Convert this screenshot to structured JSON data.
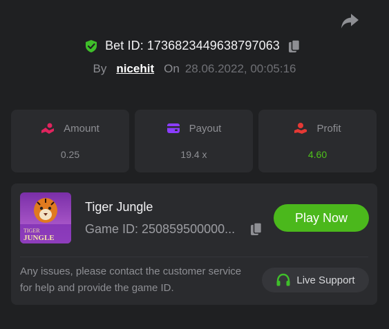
{
  "header": {
    "bet_label": "Bet ID:",
    "bet_id": "1736823449638797063",
    "by_label": "By",
    "username": "nicehit",
    "on_label": "On",
    "datetime": "28.06.2022, 00:05:16"
  },
  "stats": [
    {
      "label": "Amount",
      "value": "0.25",
      "icon": "amount-icon",
      "color": "#e0245e"
    },
    {
      "label": "Payout",
      "value": "19.4 x",
      "icon": "payout-icon",
      "color": "#8b3dff"
    },
    {
      "label": "Profit",
      "value": "4.60",
      "icon": "profit-icon",
      "color": "#e53935"
    }
  ],
  "game": {
    "title": "Tiger Jungle",
    "game_id_text": "Game ID: 250859500000...",
    "thumbnail_title_line1": "TIGER",
    "thumbnail_title_line2": "JUNGLE",
    "play_label": "Play Now"
  },
  "support": {
    "note": "Any issues, please contact the customer service for help and provide the game ID.",
    "button_label": "Live Support"
  },
  "colors": {
    "accent_green": "#4bb81c",
    "profit_green": "#4fc21b",
    "background": "#1f2022",
    "card": "#2a2b2e"
  }
}
